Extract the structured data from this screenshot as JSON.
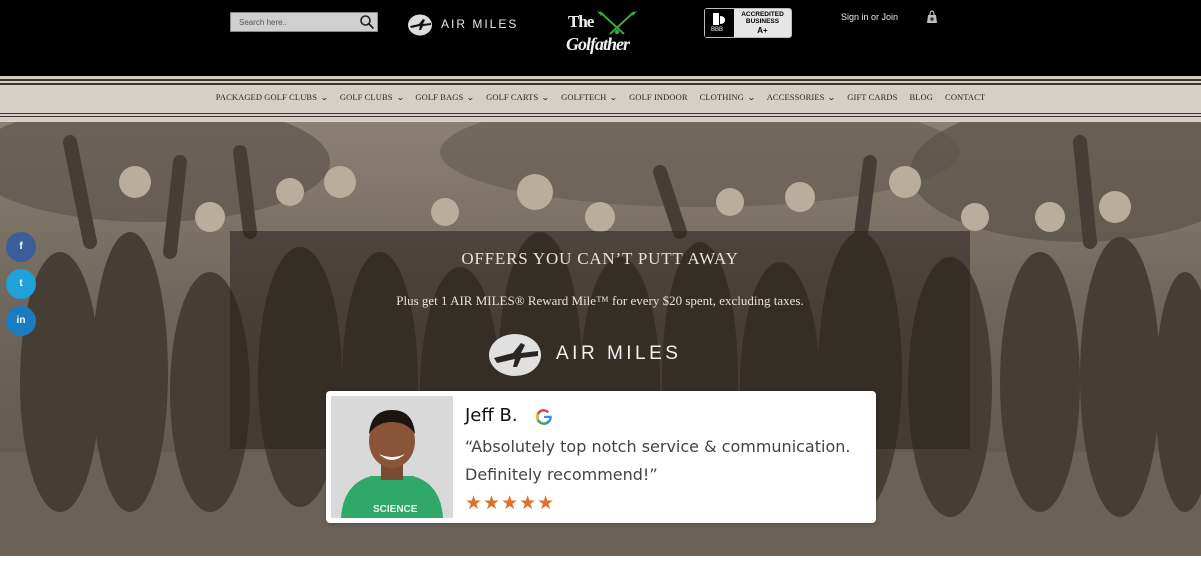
{
  "header": {
    "search_placeholder": "Search here..",
    "airmiles_label": "AIR MILES",
    "logo_line1": "The",
    "logo_line2": "Golfather",
    "bbb_accredited": "ACCREDITED BUSINESS",
    "bbb_label": "BBB",
    "bbb_rating": "A+",
    "signin_label": "Sign in or Join"
  },
  "nav": {
    "items": [
      {
        "label": "PACKAGED GOLF CLUBS",
        "dropdown": "⌄"
      },
      {
        "label": "GOLF CLUBS",
        "dropdown": "⌄"
      },
      {
        "label": "GOLF BAGS",
        "dropdown": "⌄"
      },
      {
        "label": "GOLF CARTS",
        "dropdown": "⌄"
      },
      {
        "label": "GOLFTECH",
        "dropdown": "⌄"
      },
      {
        "label": "GOLF INDOOR"
      },
      {
        "label": "CLOTHING",
        "dropdown": "⌄"
      },
      {
        "label": "ACCESSORIES",
        "dropdown": "⌄"
      },
      {
        "label": "GIFT CARDS"
      },
      {
        "label": "BLOG"
      },
      {
        "label": "CONTACT"
      }
    ]
  },
  "hero": {
    "title": "OFFERS YOU CAN’T PUTT AWAY",
    "subtitle": "Plus get 1 AIR MILES® Reward Mile™ for every $20 spent, excluding taxes.",
    "airmiles_label": "AIR MILES"
  },
  "social": {
    "facebook": "f",
    "twitter": "t",
    "linkedin": "in"
  },
  "review": {
    "name": "Jeff B.",
    "quote": "“Absolutely top notch service & communication. Definitely recommend!”",
    "stars": "★★★★★",
    "rating": 5,
    "shirt_text": "SCIENCE"
  },
  "colors": {
    "header_bg": "#000000",
    "nav_bg": "#d6cfc5",
    "star_color": "#e0702b",
    "facebook": "#3b5d9a",
    "twitter": "#1ea2d8",
    "linkedin": "#1a7bbf"
  }
}
